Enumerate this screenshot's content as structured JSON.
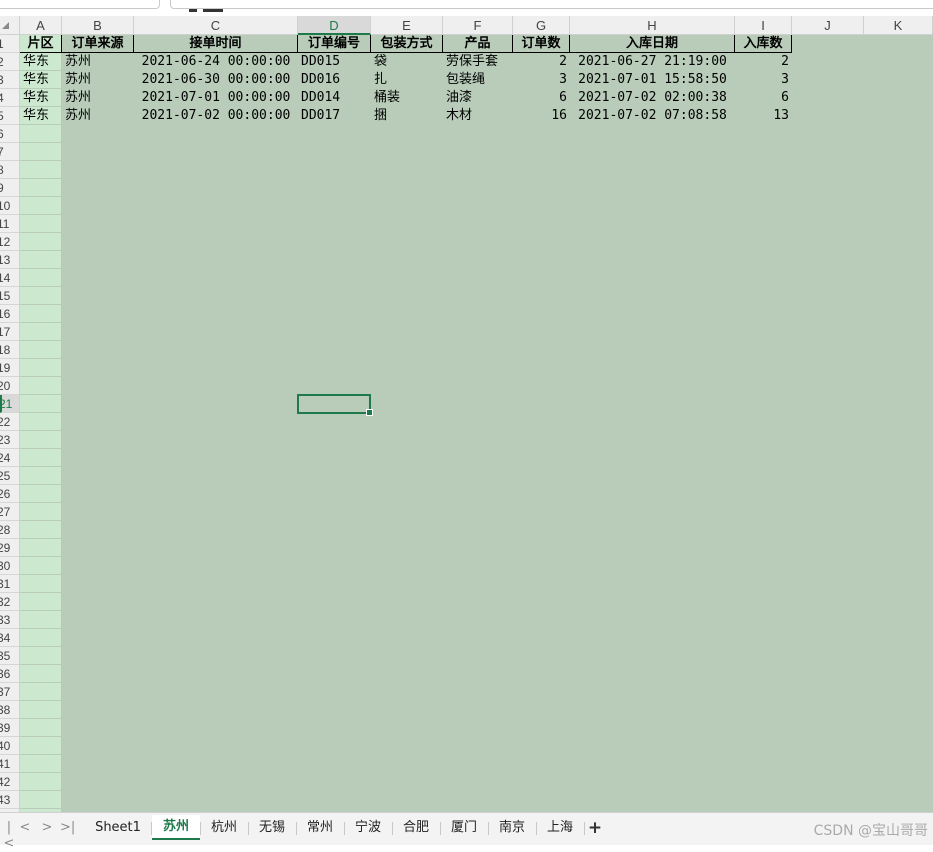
{
  "columns": [
    "A",
    "B",
    "C",
    "D",
    "E",
    "F",
    "G",
    "H",
    "I",
    "J",
    "K"
  ],
  "selected_column": "D",
  "selected_row": 21,
  "visible_rows": [
    1,
    2,
    3,
    4,
    5,
    6,
    7,
    8,
    9,
    10,
    11,
    12,
    13,
    14,
    15,
    16,
    17,
    18,
    19,
    20,
    21,
    22,
    23,
    24,
    25,
    26,
    27,
    28,
    29,
    30,
    31,
    32,
    33,
    34,
    35,
    36,
    37,
    38,
    39,
    40,
    41,
    42,
    43
  ],
  "header_row": [
    "片区",
    "订单来源",
    "接单时间",
    "订单编号",
    "包装方式",
    "产品",
    "订单数",
    "入库日期",
    "入库数"
  ],
  "rows": [
    [
      "华东",
      "苏州",
      "2021-06-24 00:00:00",
      "DD015",
      "袋",
      "劳保手套",
      "2",
      "2021-06-27 21:19:00",
      "2"
    ],
    [
      "华东",
      "苏州",
      "2021-06-30 00:00:00",
      "DD016",
      "扎",
      "包装绳",
      "3",
      "2021-07-01 15:58:50",
      "3"
    ],
    [
      "华东",
      "苏州",
      "2021-07-01 00:00:00",
      "DD014",
      "桶装",
      "油漆",
      "6",
      "2021-07-02 02:00:38",
      "6"
    ],
    [
      "华东",
      "苏州",
      "2021-07-02 00:00:00",
      "DD017",
      "捆",
      "木材",
      "16",
      "2021-07-02 07:08:58",
      "13"
    ]
  ],
  "sheet_tabs": [
    "Sheet1",
    "苏州",
    "杭州",
    "无锡",
    "常州",
    "宁波",
    "合肥",
    "厦门",
    "南京",
    "上海"
  ],
  "active_sheet": "苏州",
  "nav_buttons": [
    "|<",
    "<",
    ">",
    ">|"
  ],
  "add_sheet_label": "+",
  "watermark": "CSDN @宝山哥哥",
  "colors": {
    "cell_background": "#cce8cf",
    "gridline": "#b8ccb9",
    "accent_green": "#1e7a4a",
    "header_background": "#efefef"
  }
}
